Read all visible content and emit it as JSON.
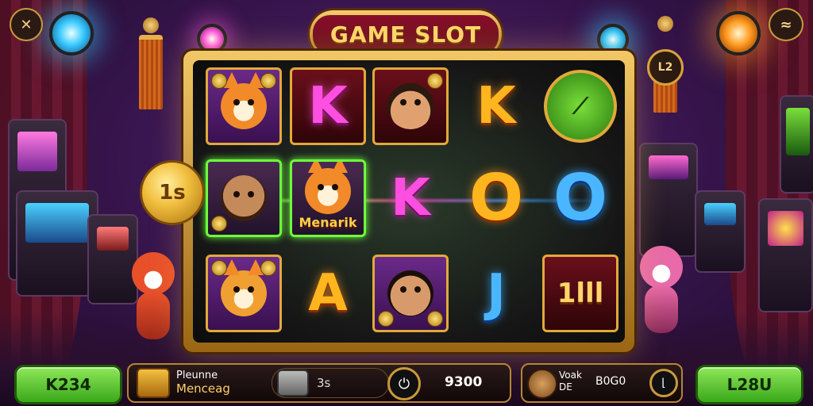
{
  "title": "GAME SLOT",
  "top_left_icon": "close-x-icon",
  "top_right_icon": "settings-menu-icon",
  "badge_text": "L2",
  "side_coin_label": "1s",
  "reels": [
    [
      "fox-symbol",
      "letter-K-pink",
      "detective-bear-symbol",
      "letter-K-orange",
      "clock-symbol"
    ],
    [
      "girl-symbol",
      "menarik-fox-symbol",
      "letter-K-pink",
      "letter-O-orange",
      "letter-O-blue"
    ],
    [
      "tiger-symbol",
      "letter-A-orange",
      "boy-symbol",
      "letter-J-blue",
      "block-symbol"
    ]
  ],
  "letters": {
    "k": "K",
    "o": "O",
    "a": "A",
    "j": "J"
  },
  "menarik_label": "Menarik",
  "block_label": "1lll",
  "left_button_label": "K234",
  "right_button_label": "L28U",
  "bottom_bar": {
    "left_line1": "Pleunne",
    "left_line2": "Menceag",
    "mid_value": "3s",
    "balance": "9300",
    "right_line1": "Voak",
    "right_line2": "DE",
    "right_value": "B0G0"
  },
  "colors": {
    "accent_gold": "#e2a93a",
    "title_red": "#8a0f2a",
    "button_green": "#3aa81a"
  }
}
